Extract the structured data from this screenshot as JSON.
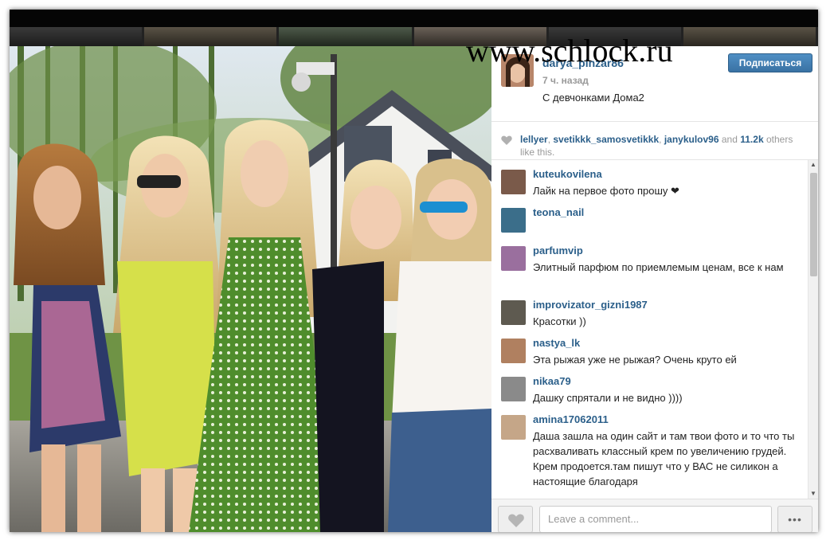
{
  "watermark": "www.schlock.ru",
  "post": {
    "username": "darya_pinzar86",
    "time": "7 ч. назад",
    "caption": "С девчонками Дома2",
    "follow_label": "Подписаться"
  },
  "likes": {
    "users": [
      "lellyer",
      "svetikkk_samosvetikkk",
      "janykulov96"
    ],
    "and_text": "and",
    "count": "11.2k",
    "suffix": "others like this."
  },
  "comments": [
    {
      "user": "kuteukovilena",
      "text": "Лайк на первое фото прошу ❤"
    },
    {
      "user": "teona_nail",
      "text": ""
    },
    {
      "user": "parfumvip",
      "text": "Элитный парфюм по приемлемым ценам, все к нам"
    },
    {
      "user": "improvizator_gizni1987",
      "text": "Красотки ))"
    },
    {
      "user": "nastya_lk",
      "text": "Эта рыжая уже не рыжая? Очень круто ей"
    },
    {
      "user": "nikaa79",
      "text": "Дашку спрятали и не видно ))))"
    },
    {
      "user": "amina17062011",
      "text": "Даша зашла на один сайт и там твои фото и то что ты расхваливать классный крем по увеличению грудей. Крем продоется.там пишут что у ВАС не силикон а настоящие благодаря"
    }
  ],
  "footer": {
    "comment_placeholder": "Leave a comment...",
    "more_label": "•••"
  },
  "icons": {
    "heart": "heart-icon",
    "more": "more-options-icon"
  },
  "colors": {
    "link": "#2b5f8a",
    "follow_button": "#3a72a4"
  }
}
